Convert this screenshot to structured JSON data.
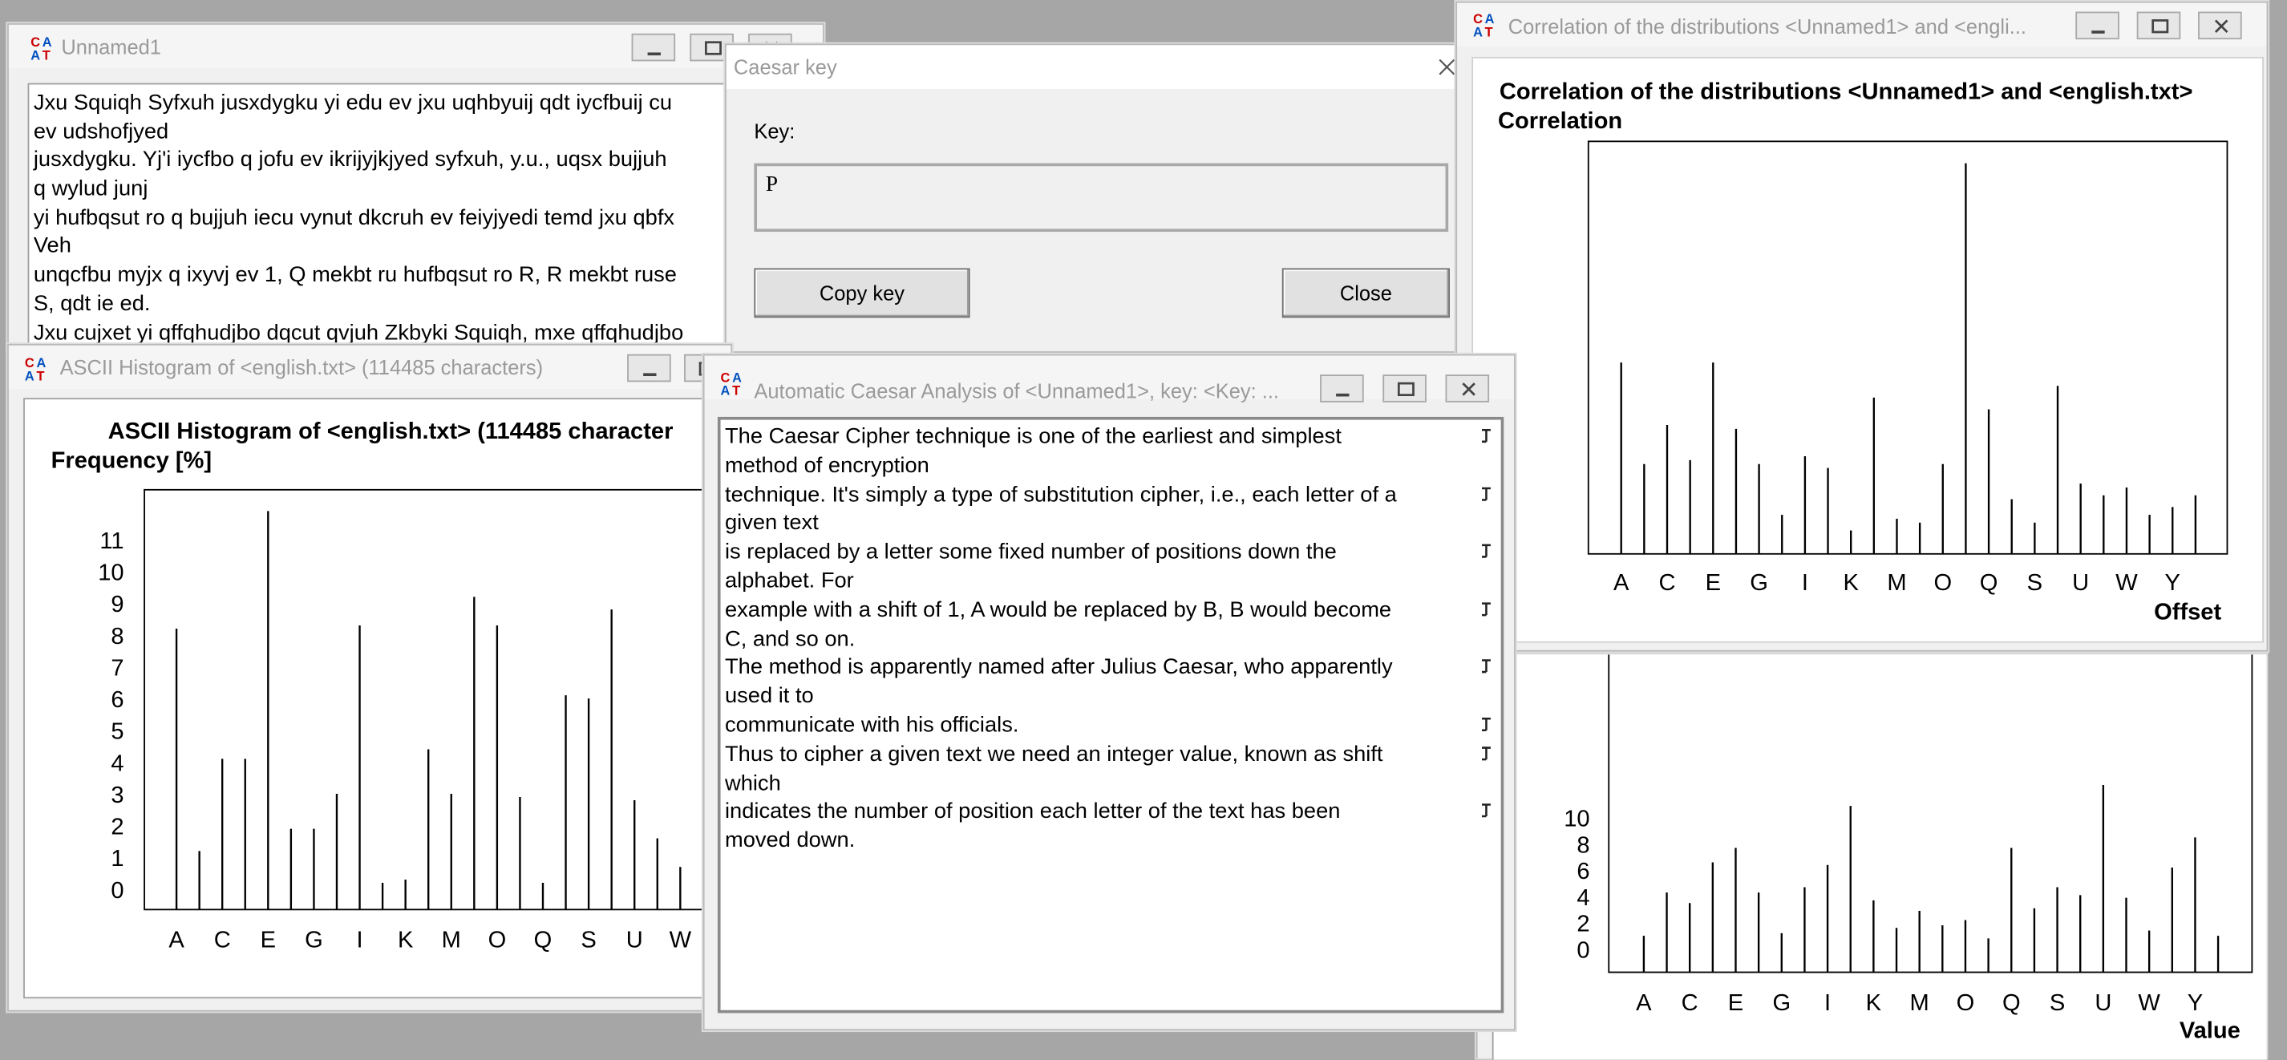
{
  "icons": {
    "app": "cryptool-icon",
    "minimize": "minimize-icon",
    "maximize": "maximize-icon",
    "close": "close-icon",
    "paragraph": "paragraph-mark-icon"
  },
  "editor": {
    "title": "Unnamed1",
    "lines": [
      "Jxu Squiqh Syfxuh jusxdygku yi edu ev jxu uqhbyuij qdt iycfbuij cu",
      "ev udshofjyed",
      "jusxdygku. Yj'i iycfbo q jofu ev ikrijyjkjyed syfxuh, y.u., uqsx bujjuh",
      "q wylud junj",
      "yi hufbqsut ro q bujjuh iecu vynut dkcruh ev feiyjyedi temd jxu qbfx",
      "Veh",
      "unqcfbu myjx q ixyvj ev 1, Q mekbt ru hufbqsut ro R, R mekbt ruse",
      "S, qdt ie ed.",
      "Jxu cujxet yi qffqhudjbo dqcut qvjuh Zkbyki Squiqh, mxe qffqhudjbo"
    ]
  },
  "caesar_key": {
    "title": "Caesar key",
    "key_label": "Key:",
    "key_value": "P",
    "copy_button": "Copy key",
    "close_button": "Close"
  },
  "histogram": {
    "window_title": "ASCII Histogram of <english.txt> (114485 characters)",
    "chart_title": "ASCII Histogram of <english.txt> (114485 character",
    "y_axis_label": "Frequency [%]",
    "y_ticks": [
      "0",
      "1",
      "2",
      "3",
      "4",
      "5",
      "6",
      "7",
      "8",
      "9",
      "10",
      "11"
    ],
    "x_ticks": [
      "A",
      "C",
      "E",
      "G",
      "I",
      "K",
      "M",
      "O",
      "Q",
      "S",
      "U",
      "W"
    ]
  },
  "analysis": {
    "title": "Automatic Caesar Analysis of <Unnamed1>, key: <Key: ...",
    "paragraphs": [
      [
        "The Caesar Cipher technique is one of the earliest and simplest",
        "method of encryption"
      ],
      [
        "technique. It's simply a type of substitution cipher, i.e., each letter of a",
        "given text"
      ],
      [
        "is replaced by a letter some fixed number of positions down the",
        "alphabet. For"
      ],
      [
        "example with a shift of 1, A would be replaced by B, B would become",
        "C, and so on."
      ],
      [
        "The method is apparently named after Julius Caesar, who apparently",
        "used it to"
      ],
      [
        "communicate with his officials."
      ],
      [
        "Thus to cipher a given text we need an integer value, known as shift",
        "which"
      ],
      [
        "indicates the number of position each letter of the text has been",
        "moved down."
      ]
    ]
  },
  "correlation": {
    "window_title": "Correlation of the distributions <Unnamed1> and <engli...",
    "chart_title": "Correlation of the distributions <Unnamed1> and <english.txt>",
    "y_axis_label": "Correlation",
    "x_axis_label": "Offset",
    "x_ticks": [
      "A",
      "C",
      "E",
      "G",
      "I",
      "K",
      "M",
      "O",
      "Q",
      "S",
      "U",
      "W",
      "Y"
    ]
  },
  "bottom_histogram": {
    "y_ticks": [
      "0",
      "2",
      "4",
      "6",
      "8",
      "10"
    ],
    "x_ticks": [
      "A",
      "C",
      "E",
      "G",
      "I",
      "K",
      "M",
      "O",
      "Q",
      "S",
      "U",
      "W",
      "Y"
    ],
    "x_axis_label": "Value"
  },
  "chart_data": [
    {
      "type": "bar",
      "title": "ASCII Histogram of <english.txt> (114485 character",
      "ylabel": "Frequency [%]",
      "xlabel": "",
      "ylim": [
        0,
        12
      ],
      "categories": [
        "A",
        "B",
        "C",
        "D",
        "E",
        "F",
        "G",
        "H",
        "I",
        "J",
        "K",
        "L",
        "M",
        "N",
        "O",
        "P",
        "Q",
        "R",
        "S",
        "T",
        "U",
        "V",
        "W"
      ],
      "values": [
        8.2,
        1.2,
        4.1,
        4.1,
        11.9,
        1.9,
        1.9,
        3.0,
        8.3,
        0.2,
        0.3,
        4.4,
        3.0,
        9.2,
        8.3,
        2.9,
        0.2,
        6.1,
        6.0,
        8.8,
        2.8,
        1.6,
        0.7
      ]
    },
    {
      "type": "bar",
      "title": "Correlation of the distributions <Unnamed1> and <english.txt>",
      "ylabel": "Correlation",
      "xlabel": "Offset",
      "categories": [
        "A",
        "B",
        "C",
        "D",
        "E",
        "F",
        "G",
        "H",
        "I",
        "J",
        "K",
        "L",
        "M",
        "N",
        "O",
        "P",
        "Q",
        "R",
        "S",
        "T",
        "U",
        "V",
        "W",
        "X",
        "Y",
        "Z"
      ],
      "values": [
        0.49,
        0.23,
        0.33,
        0.24,
        0.49,
        0.32,
        0.23,
        0.1,
        0.25,
        0.22,
        0.06,
        0.4,
        0.09,
        0.08,
        0.23,
        1.0,
        0.37,
        0.14,
        0.08,
        0.43,
        0.18,
        0.15,
        0.17,
        0.1,
        0.12,
        0.15
      ]
    },
    {
      "type": "bar",
      "xlabel": "Value",
      "ylim": [
        0,
        11
      ],
      "categories": [
        "A",
        "B",
        "C",
        "D",
        "E",
        "F",
        "G",
        "H",
        "I",
        "J",
        "K",
        "L",
        "M",
        "N",
        "O",
        "P",
        "Q",
        "R",
        "S",
        "T",
        "U",
        "V",
        "W",
        "X",
        "Y",
        "Z"
      ],
      "values": [
        1.0,
        4.3,
        3.5,
        6.6,
        7.7,
        4.3,
        1.2,
        4.7,
        6.4,
        10.9,
        3.7,
        1.6,
        2.9,
        1.8,
        2.2,
        0.8,
        7.7,
        3.1,
        4.7,
        4.1,
        12.5,
        3.9,
        1.4,
        6.2,
        8.5,
        1.0
      ]
    }
  ]
}
